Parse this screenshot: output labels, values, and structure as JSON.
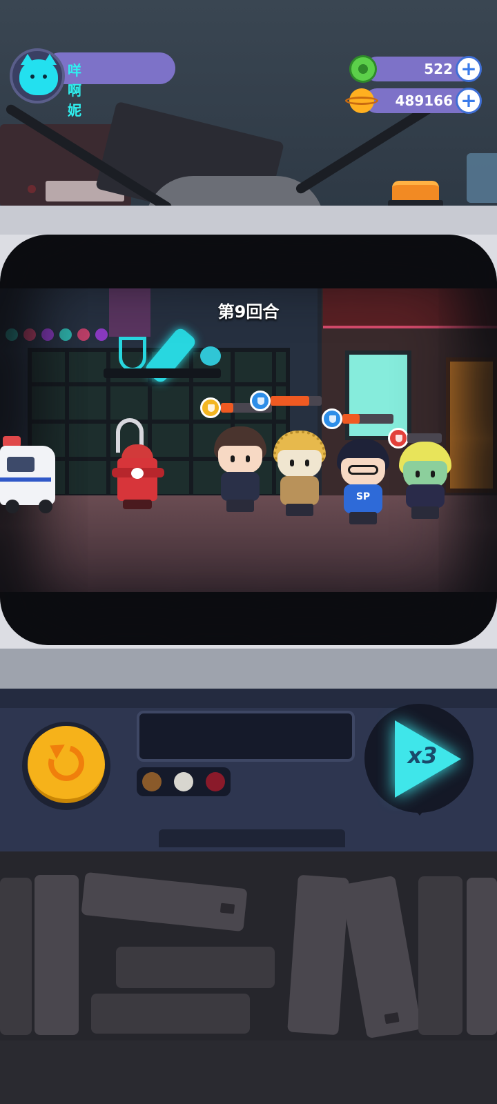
{
  "player": {
    "name": "咩啊妮",
    "avatar_icon": "cat-avatar-icon"
  },
  "currency": {
    "gems": {
      "icon": "donut-gem-icon",
      "value": "522",
      "add_icon": "plus-icon"
    },
    "coins": {
      "icon": "planet-coin-icon",
      "value": "489166",
      "add_icon": "plus-icon"
    }
  },
  "battle": {
    "round_label": "第9回合",
    "units": [
      {
        "name": "fire-hydrant-enemy"
      },
      {
        "name": "hero-brown-hair",
        "badge": "gold"
      },
      {
        "name": "hero-golden-hair",
        "badge": "blue",
        "hp_fraction": 0.75
      },
      {
        "name": "hero-glasses",
        "badge": "blue",
        "hp_fraction": 0.4,
        "shirt_text": "SP"
      },
      {
        "name": "hero-zombie",
        "badge": "red",
        "hp_fraction": 0.0
      }
    ]
  },
  "controls": {
    "retry_icon": "retry-icon",
    "speed_label": "x3",
    "display_text": "",
    "indicator_colors": [
      "#8a5a2a",
      "#d8d6cf",
      "#8a1a2a"
    ]
  },
  "colors": {
    "pill": "#7d72c8",
    "accent_cyan": "#3fe6ea",
    "gold_button": "#f6b21a",
    "hp_orange": "#ef5a22"
  }
}
